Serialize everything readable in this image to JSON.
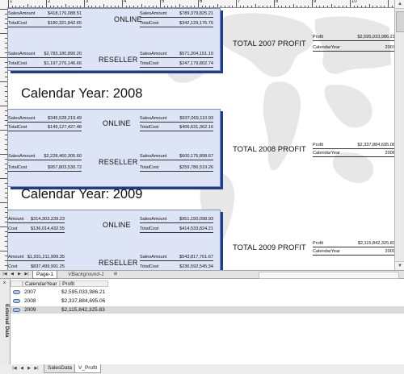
{
  "ruler": {
    "labels": [
      "1",
      "2",
      "3",
      "4",
      "5",
      "6",
      "7",
      "8",
      "9",
      "10"
    ]
  },
  "sections": [
    {
      "year_title": "",
      "online": {
        "label": "ONLINE",
        "left": [
          {
            "label": "SalesAmount",
            "value": "$418,176,088.51"
          },
          {
            "label": "TotalCost",
            "value": "$180,321,842.65"
          }
        ],
        "right": [
          {
            "label": "SalesAmount",
            "value": "$789,379,825.21"
          },
          {
            "label": "TotalCost",
            "value": "$342,129,176.76"
          }
        ]
      },
      "reseller": {
        "label": "RESELLER",
        "left": [
          {
            "label": "SalesAmount",
            "value": "$2,783,180,890.20"
          },
          {
            "label": "TotalCost",
            "value": "$1,197,276,146.66"
          }
        ],
        "right": [
          {
            "label": "SalesAmount",
            "value": "$571,204,151.10"
          },
          {
            "label": "TotalCost",
            "value": "$247,179,802.74"
          }
        ]
      },
      "profit": {
        "title": "TOTAL 2007 PROFIT",
        "rows": [
          {
            "label": "Profit",
            "value": "$2,595,033,986.21"
          },
          {
            "label": "CalendarYear",
            "value": "2007"
          }
        ]
      }
    },
    {
      "year_title": "Calendar Year: 2008",
      "online": {
        "label": "ONLINE",
        "left": [
          {
            "label": "SalesAmount",
            "value": "$345,528,219.49"
          },
          {
            "label": "TotalCost",
            "value": "$149,127,427.48"
          }
        ],
        "right": [
          {
            "label": "SalesAmount",
            "value": "$937,069,110.93"
          },
          {
            "label": "TotalCost",
            "value": "$406,631,362.16"
          }
        ]
      },
      "reseller": {
        "label": "RESELLER",
        "left": [
          {
            "label": "SalesAmount",
            "value": "$2,228,460,305.60"
          },
          {
            "label": "TotalCost",
            "value": "$957,803,530.72"
          }
        ],
        "right": [
          {
            "label": "SalesAmount",
            "value": "$600,175,898.67"
          },
          {
            "label": "TotalCost",
            "value": "$259,786,519.26"
          }
        ]
      },
      "profit": {
        "title": "TOTAL 2008 PROFIT",
        "rows": [
          {
            "label": "Profit",
            "value": "$2,337,884,695.06"
          },
          {
            "label": "CalendarYear",
            "value": "2008"
          }
        ]
      }
    },
    {
      "year_title": "Calendar Year: 2009",
      "online": {
        "label": "ONLINE",
        "left": [
          {
            "label": "Amount",
            "value": "$314,303,239.23"
          },
          {
            "label": "Cost",
            "value": "$136,014,432.55"
          }
        ],
        "right": [
          {
            "label": "SalesAmount",
            "value": "$951,150,098.93"
          },
          {
            "label": "TotalCost",
            "value": "$414,533,824.21"
          }
        ]
      },
      "reseller": {
        "label": "RESELLER",
        "left": [
          {
            "label": "Amount",
            "value": "$1,931,211,999.35"
          },
          {
            "label": "Cost",
            "value": "$837,499,991.25"
          }
        ],
        "right": [
          {
            "label": "SalesAmount",
            "value": "$543,817,761.67"
          },
          {
            "label": "TotalCost",
            "value": "$236,592,545.34"
          }
        ]
      },
      "profit": {
        "title": "TOTAL 2009 PROFIT",
        "rows": [
          {
            "label": "Profit",
            "value": "$2,115,842,325.83"
          },
          {
            "label": "CalendarYear",
            "value": "2009"
          }
        ]
      }
    }
  ],
  "page_tabs": {
    "active": "Page-1",
    "inactive": "VBackground-1"
  },
  "external_data": {
    "title": "External Data",
    "columns": [
      "CalendarYear",
      "Profit"
    ],
    "rows": [
      {
        "year": "2007",
        "profit": "$2,595,033,986.21"
      },
      {
        "year": "2008",
        "profit": "$2,337,884,695.06"
      },
      {
        "year": "2009",
        "profit": "$2,115,842,325.83"
      }
    ],
    "selected_row": 2
  },
  "sheet_tabs": [
    "SalesData",
    "V_Profit"
  ],
  "active_sheet": "V_Profit"
}
